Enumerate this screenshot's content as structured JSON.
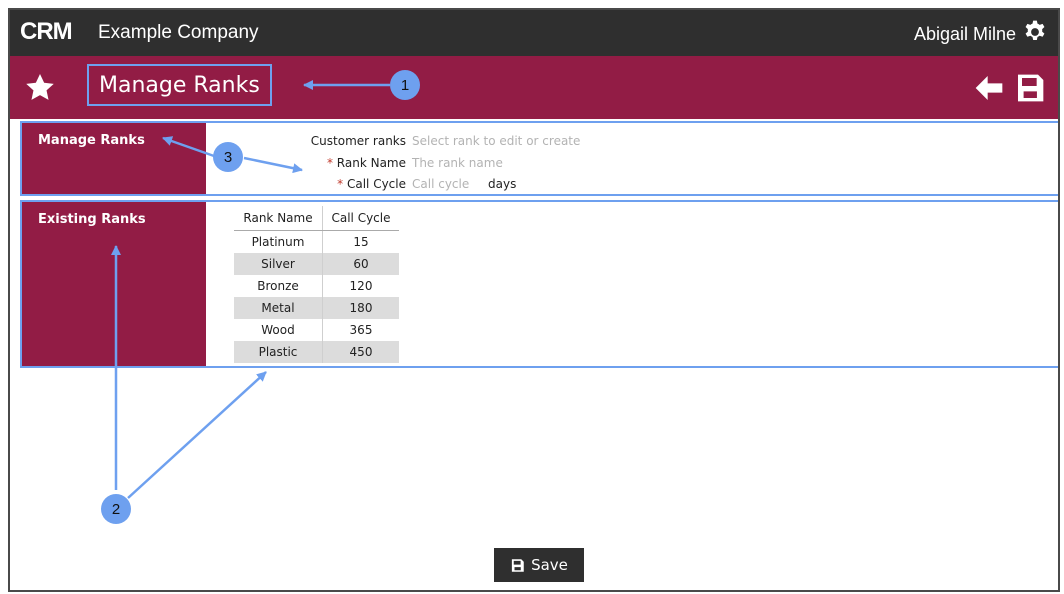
{
  "topbar": {
    "logo": "CRM",
    "company": "Example Company",
    "user": "Abigail Milne",
    "settings_icon": "gear-icon"
  },
  "header": {
    "title": "Manage Ranks",
    "favorite_icon": "star-icon",
    "back_icon": "arrow-left-icon",
    "save_icon": "floppy-disk-icon"
  },
  "manage_ranks": {
    "section_label": "Manage Ranks",
    "customer_ranks_label": "Customer ranks",
    "customer_ranks_placeholder": "Select rank to edit or create",
    "required_marker": "*",
    "rank_name_label": "Rank Name",
    "rank_name_placeholder": "The rank name",
    "call_cycle_label": "Call Cycle",
    "call_cycle_placeholder": "Call cycle",
    "call_cycle_unit": "days"
  },
  "existing_ranks": {
    "section_label": "Existing Ranks",
    "columns": [
      "Rank Name",
      "Call Cycle"
    ],
    "rows": [
      [
        "Platinum",
        "15"
      ],
      [
        "Silver",
        "60"
      ],
      [
        "Bronze",
        "120"
      ],
      [
        "Metal",
        "180"
      ],
      [
        "Wood",
        "365"
      ],
      [
        "Plastic",
        "450"
      ]
    ]
  },
  "footer": {
    "save_label": "Save"
  },
  "callouts": [
    "1",
    "2",
    "3"
  ],
  "colors": {
    "brand": "#921c45",
    "topbar": "#2f2f2f",
    "annotation": "#6ea0ef"
  }
}
